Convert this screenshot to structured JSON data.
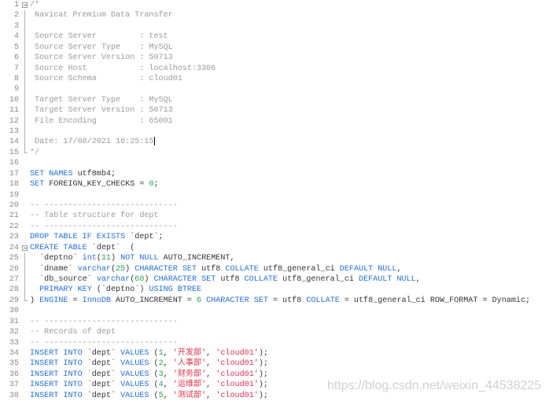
{
  "colors": {
    "keyword": "#1f6fe5",
    "number": "#21a84a",
    "string": "#e8304a",
    "comment": "#9a9a9a",
    "text": "#333333"
  },
  "watermark": "https://blog.csdn.net/weixin_44538225",
  "lines": [
    {
      "n": "1",
      "fold": "box",
      "tokens": [
        [
          "c",
          "/*"
        ]
      ]
    },
    {
      "n": "2",
      "fold": "bar",
      "tokens": [
        [
          "c",
          " Navicat Premium Data Transfer"
        ]
      ]
    },
    {
      "n": "3",
      "fold": "bar",
      "tokens": []
    },
    {
      "n": "4",
      "fold": "bar",
      "tokens": [
        [
          "c",
          " Source Server         : test"
        ]
      ]
    },
    {
      "n": "5",
      "fold": "bar",
      "tokens": [
        [
          "c",
          " Source Server Type    : MySQL"
        ]
      ]
    },
    {
      "n": "6",
      "fold": "bar",
      "tokens": [
        [
          "c",
          " Source Server Version : 50713"
        ]
      ]
    },
    {
      "n": "7",
      "fold": "bar",
      "tokens": [
        [
          "c",
          " Source Host           : localhost:3306"
        ]
      ]
    },
    {
      "n": "8",
      "fold": "bar",
      "tokens": [
        [
          "c",
          " Source Schema         : cloud01"
        ]
      ]
    },
    {
      "n": "9",
      "fold": "bar",
      "tokens": []
    },
    {
      "n": "10",
      "fold": "bar",
      "tokens": [
        [
          "c",
          " Target Server Type    : MySQL"
        ]
      ]
    },
    {
      "n": "11",
      "fold": "bar",
      "tokens": [
        [
          "c",
          " Target Server Version : 50713"
        ]
      ]
    },
    {
      "n": "12",
      "fold": "bar",
      "tokens": [
        [
          "c",
          " File Encoding         : 65001"
        ]
      ]
    },
    {
      "n": "13",
      "fold": "bar",
      "tokens": []
    },
    {
      "n": "14",
      "fold": "bar",
      "cursor": true,
      "tokens": [
        [
          "c",
          " Date: 17/08/2021 16:25:15"
        ]
      ]
    },
    {
      "n": "15",
      "fold": "end",
      "tokens": [
        [
          "c",
          "*/"
        ]
      ]
    },
    {
      "n": "16",
      "fold": "",
      "tokens": []
    },
    {
      "n": "17",
      "fold": "",
      "tokens": [
        [
          "k",
          "SET NAMES"
        ],
        [
          "t",
          " utf8mb4;"
        ]
      ]
    },
    {
      "n": "18",
      "fold": "",
      "tokens": [
        [
          "k",
          "SET"
        ],
        [
          "t",
          " FOREIGN_KEY_CHECKS = "
        ],
        [
          "n",
          "0"
        ],
        [
          "t",
          ";"
        ]
      ]
    },
    {
      "n": "19",
      "fold": "",
      "tokens": []
    },
    {
      "n": "20",
      "fold": "",
      "tokens": [
        [
          "c",
          "-- ----------------------------"
        ]
      ]
    },
    {
      "n": "21",
      "fold": "",
      "tokens": [
        [
          "c",
          "-- Table structure for dept"
        ]
      ]
    },
    {
      "n": "22",
      "fold": "",
      "tokens": [
        [
          "c",
          "-- ----------------------------"
        ]
      ]
    },
    {
      "n": "23",
      "fold": "",
      "tokens": [
        [
          "k",
          "DROP TABLE IF EXISTS"
        ],
        [
          "t",
          " `dept`;"
        ]
      ]
    },
    {
      "n": "24",
      "fold": "box",
      "tokens": [
        [
          "k",
          "CREATE TABLE"
        ],
        [
          "t",
          " `dept`  ("
        ]
      ]
    },
    {
      "n": "25",
      "fold": "bar",
      "tokens": [
        [
          "t",
          "  `deptno` "
        ],
        [
          "k",
          "int"
        ],
        [
          "t",
          "("
        ],
        [
          "n",
          "11"
        ],
        [
          "t",
          ") "
        ],
        [
          "k",
          "NOT NULL"
        ],
        [
          "t",
          " AUTO_INCREMENT,"
        ]
      ]
    },
    {
      "n": "26",
      "fold": "bar",
      "tokens": [
        [
          "t",
          "  `dname` "
        ],
        [
          "k",
          "varchar"
        ],
        [
          "t",
          "("
        ],
        [
          "n",
          "25"
        ],
        [
          "t",
          ") "
        ],
        [
          "k",
          "CHARACTER SET"
        ],
        [
          "t",
          " utf8 "
        ],
        [
          "k",
          "COLLATE"
        ],
        [
          "t",
          " utf8_general_ci "
        ],
        [
          "k",
          "DEFAULT NULL"
        ],
        [
          "t",
          ","
        ]
      ]
    },
    {
      "n": "27",
      "fold": "bar",
      "tokens": [
        [
          "t",
          "  `db_source` "
        ],
        [
          "k",
          "varchar"
        ],
        [
          "t",
          "("
        ],
        [
          "n",
          "60"
        ],
        [
          "t",
          ") "
        ],
        [
          "k",
          "CHARACTER SET"
        ],
        [
          "t",
          " utf8 "
        ],
        [
          "k",
          "COLLATE"
        ],
        [
          "t",
          " utf8_general_ci "
        ],
        [
          "k",
          "DEFAULT NULL"
        ],
        [
          "t",
          ","
        ]
      ]
    },
    {
      "n": "28",
      "fold": "bar",
      "tokens": [
        [
          "t",
          "  "
        ],
        [
          "k",
          "PRIMARY KEY"
        ],
        [
          "t",
          " (`deptno`) "
        ],
        [
          "k",
          "USING BTREE"
        ]
      ]
    },
    {
      "n": "29",
      "fold": "end",
      "tokens": [
        [
          "t",
          ") "
        ],
        [
          "k",
          "ENGINE"
        ],
        [
          "t",
          " = "
        ],
        [
          "k",
          "InnoDB"
        ],
        [
          "t",
          " AUTO_INCREMENT = "
        ],
        [
          "n",
          "6"
        ],
        [
          "t",
          " "
        ],
        [
          "k",
          "CHARACTER SET"
        ],
        [
          "t",
          " = utf8 "
        ],
        [
          "k",
          "COLLATE"
        ],
        [
          "t",
          " = utf8_general_ci ROW_FORMAT = Dynamic;"
        ]
      ]
    },
    {
      "n": "30",
      "fold": "",
      "tokens": []
    },
    {
      "n": "31",
      "fold": "",
      "tokens": [
        [
          "c",
          "-- ----------------------------"
        ]
      ]
    },
    {
      "n": "32",
      "fold": "",
      "tokens": [
        [
          "c",
          "-- Records of dept"
        ]
      ]
    },
    {
      "n": "33",
      "fold": "",
      "tokens": [
        [
          "c",
          "-- ----------------------------"
        ]
      ]
    },
    {
      "n": "34",
      "fold": "",
      "tokens": [
        [
          "k",
          "INSERT INTO"
        ],
        [
          "t",
          " `dept` "
        ],
        [
          "k",
          "VALUES"
        ],
        [
          "t",
          " ("
        ],
        [
          "n",
          "1"
        ],
        [
          "t",
          ", "
        ],
        [
          "s",
          "'开发部'"
        ],
        [
          "t",
          ", "
        ],
        [
          "s",
          "'cloud01'"
        ],
        [
          "t",
          ");"
        ]
      ]
    },
    {
      "n": "35",
      "fold": "",
      "tokens": [
        [
          "k",
          "INSERT INTO"
        ],
        [
          "t",
          " `dept` "
        ],
        [
          "k",
          "VALUES"
        ],
        [
          "t",
          " ("
        ],
        [
          "n",
          "2"
        ],
        [
          "t",
          ", "
        ],
        [
          "s",
          "'人事部'"
        ],
        [
          "t",
          ", "
        ],
        [
          "s",
          "'cloud01'"
        ],
        [
          "t",
          ");"
        ]
      ]
    },
    {
      "n": "36",
      "fold": "",
      "tokens": [
        [
          "k",
          "INSERT INTO"
        ],
        [
          "t",
          " `dept` "
        ],
        [
          "k",
          "VALUES"
        ],
        [
          "t",
          " ("
        ],
        [
          "n",
          "3"
        ],
        [
          "t",
          ", "
        ],
        [
          "s",
          "'财务部'"
        ],
        [
          "t",
          ", "
        ],
        [
          "s",
          "'cloud01'"
        ],
        [
          "t",
          ");"
        ]
      ]
    },
    {
      "n": "37",
      "fold": "",
      "tokens": [
        [
          "k",
          "INSERT INTO"
        ],
        [
          "t",
          " `dept` "
        ],
        [
          "k",
          "VALUES"
        ],
        [
          "t",
          " ("
        ],
        [
          "n",
          "4"
        ],
        [
          "t",
          ", "
        ],
        [
          "s",
          "'运维部'"
        ],
        [
          "t",
          ", "
        ],
        [
          "s",
          "'cloud01'"
        ],
        [
          "t",
          ");"
        ]
      ]
    },
    {
      "n": "38",
      "fold": "",
      "tokens": [
        [
          "k",
          "INSERT INTO"
        ],
        [
          "t",
          " `dept` "
        ],
        [
          "k",
          "VALUES"
        ],
        [
          "t",
          " ("
        ],
        [
          "n",
          "5"
        ],
        [
          "t",
          ", "
        ],
        [
          "s",
          "'测试部'"
        ],
        [
          "t",
          ", "
        ],
        [
          "s",
          "'cloud01'"
        ],
        [
          "t",
          ");"
        ]
      ]
    }
  ]
}
